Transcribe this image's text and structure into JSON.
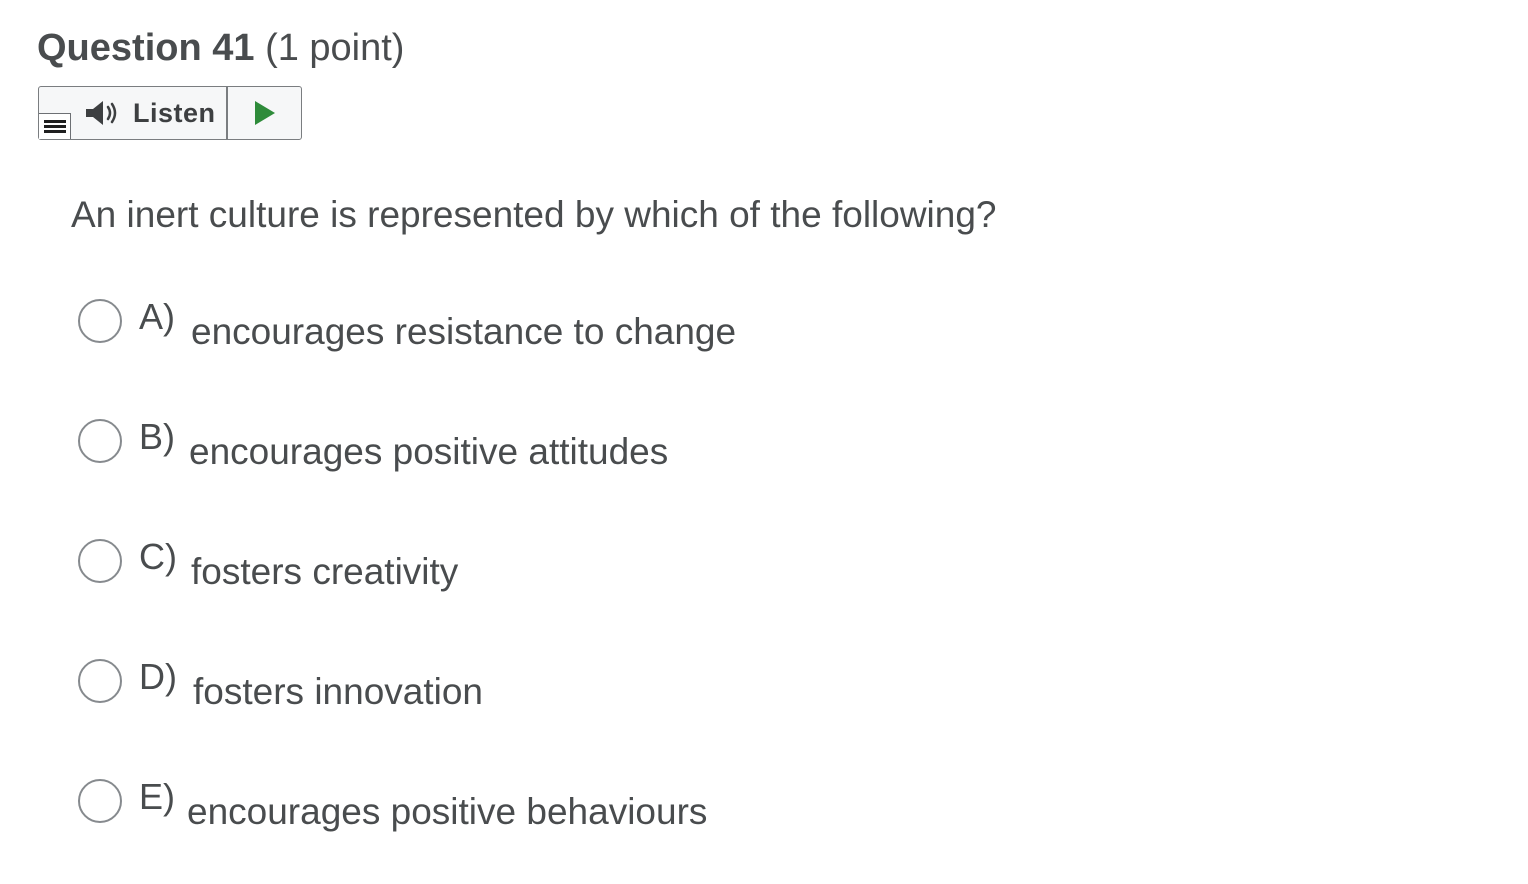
{
  "question": {
    "title": "Question 41",
    "points": "(1 point)",
    "text": "An inert culture is represented by which of the following?"
  },
  "listen": {
    "label": "Listen",
    "menu_icon": "menu-lines-icon",
    "speaker_icon": "speaker-icon",
    "play_icon": "play-icon",
    "play_color": "#2e8b3a"
  },
  "options": [
    {
      "letter": "A)",
      "text": "encourages resistance to change"
    },
    {
      "letter": "B)",
      "text": "encourages positive attitudes"
    },
    {
      "letter": "C)",
      "text": "fosters creativity"
    },
    {
      "letter": "D)",
      "text": "fosters innovation"
    },
    {
      "letter": "E)",
      "text": "encourages positive behaviours"
    }
  ]
}
